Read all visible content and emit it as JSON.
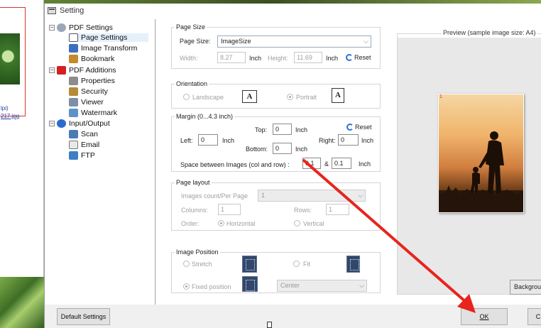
{
  "background_app": {
    "thumb_label_1": "lpi)",
    "thumb_label_2": "217.jpg"
  },
  "window": {
    "title": "Setting"
  },
  "tree": {
    "groups": [
      {
        "label": "PDF Settings",
        "toggle": "−",
        "items": [
          "Page Settings",
          "Image Transform",
          "Bookmark"
        ]
      },
      {
        "label": "PDF Additions",
        "toggle": "−",
        "items": [
          "Properties",
          "Security",
          "Viewer",
          "Watermark"
        ]
      },
      {
        "label": "Input/Output",
        "toggle": "−",
        "items": [
          "Scan",
          "Email",
          "FTP"
        ]
      }
    ],
    "selected": "Page Settings"
  },
  "page_size": {
    "title": "Page Size",
    "size_label": "Page Size:",
    "size_value": "ImageSize",
    "width_label": "Width:",
    "width_value": "8.27",
    "width_unit": "Inch",
    "height_label": "Height:",
    "height_value": "11.69",
    "height_unit": "Inch",
    "reset_label": "Reset"
  },
  "orientation": {
    "title": "Orientation",
    "landscape_label": "Landscape",
    "portrait_label": "Portrait",
    "icon_glyph": "A",
    "selected": "Portrait"
  },
  "margin": {
    "title": "Margin (0...4.3 inch)",
    "top_label": "Top:",
    "top_value": "0",
    "top_unit": "Inch",
    "left_label": "Left:",
    "left_value": "0",
    "left_unit": "Inch",
    "right_label": "Right:",
    "right_value": "0",
    "right_unit": "Inch",
    "bottom_label": "Bottom:",
    "bottom_value": "0",
    "bottom_unit": "Inch",
    "reset_label": "Reset",
    "spacing_label": "Space between Images (col and row) :",
    "spacing_col": "0.1",
    "spacing_sep": "&",
    "spacing_row": "0.1",
    "spacing_unit": "Inch"
  },
  "page_layout": {
    "title": "Page layout",
    "count_label": "Images count/Per Page",
    "count_value": "1",
    "columns_label": "Columns:",
    "columns_value": "1",
    "rows_label": "Rows:",
    "rows_value": "1",
    "order_label": "Order:",
    "horizontal_label": "Horizontal",
    "vertical_label": "Vertical",
    "selected_order": "Horizontal"
  },
  "image_position": {
    "title": "Image Position",
    "stretch_label": "Stretch",
    "fit_label": "Fit",
    "fixed_label": "Fixed position",
    "fixed_value": "Center",
    "selected": "Fixed position"
  },
  "preview": {
    "title": "Preview (sample image size: A4)",
    "page_number": "1",
    "background_button": "Backgrou"
  },
  "buttons": {
    "default_settings": "Default Settings",
    "ok": "OK",
    "cancel_partial": "C"
  },
  "colors": {
    "annotation_arrow": "#e8241c",
    "selection": "#e5f0fb",
    "accent_blue": "#2b6fd6"
  }
}
